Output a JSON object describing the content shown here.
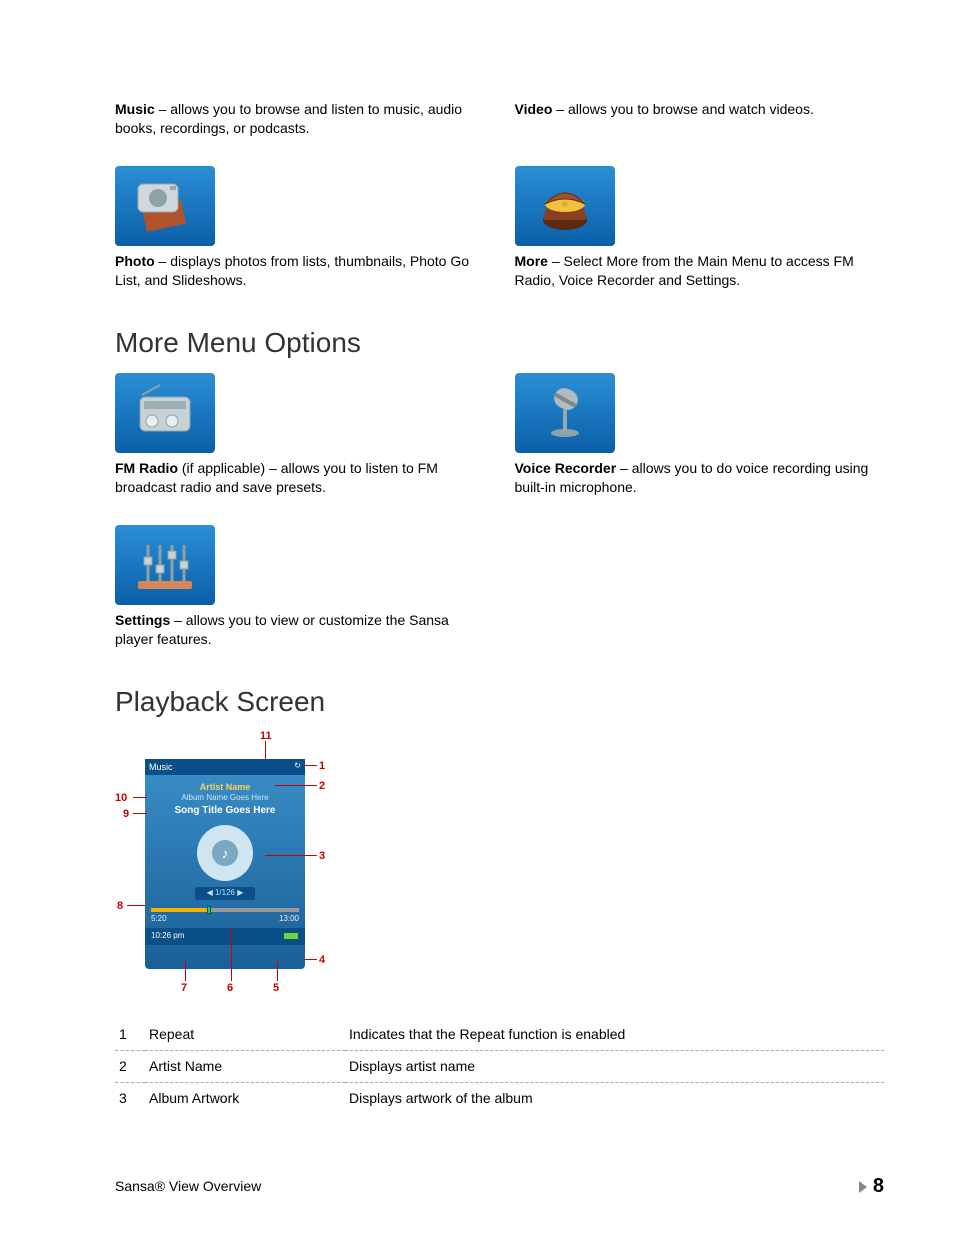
{
  "features_row1": {
    "left": {
      "title": "Music",
      "text": " – allows you to browse and listen to music, audio books, recordings, or podcasts."
    },
    "right": {
      "title": "Video",
      "text": " – allows you to browse and watch videos."
    }
  },
  "features_row2": {
    "left": {
      "title": "Photo",
      "text": " – displays photos from lists, thumbnails, Photo Go List, and Slideshows."
    },
    "right": {
      "title": "More",
      "text": " – Select More from the Main Menu to access FM Radio, Voice Recorder and Settings."
    }
  },
  "section_more_heading": "More Menu Options",
  "features_row3": {
    "left": {
      "title": "FM Radio",
      "text": " (if applicable) – allows you to listen to FM broadcast radio and save presets."
    },
    "right": {
      "title": "Voice Recorder",
      "text": " – allows you to do voice recording using built-in microphone."
    }
  },
  "features_row4": {
    "left": {
      "title": "Settings",
      "text": " – allows you to view or customize the Sansa player features."
    }
  },
  "section_playback_heading": "Playback Screen",
  "playback_screen": {
    "header": "Music",
    "artist": "Artist Name",
    "album": "Album Name Goes Here",
    "song": "Song Title Goes Here",
    "pager": "◀ 1/126 ▶",
    "elapsed": "5:20",
    "total": "13:00",
    "clock": "10:26 pm"
  },
  "callouts": {
    "c1": "1",
    "c2": "2",
    "c3": "3",
    "c4": "4",
    "c5": "5",
    "c6": "6",
    "c7": "7",
    "c8": "8",
    "c9": "9",
    "c10": "10",
    "c11": "11"
  },
  "legend": [
    {
      "num": "1",
      "name": "Repeat",
      "desc": "Indicates that the Repeat function is enabled"
    },
    {
      "num": "2",
      "name": "Artist Name",
      "desc": "Displays artist name"
    },
    {
      "num": "3",
      "name": "Album Artwork",
      "desc": "Displays artwork of the album"
    }
  ],
  "footer": {
    "left": "Sansa® View Overview",
    "page": "8"
  }
}
